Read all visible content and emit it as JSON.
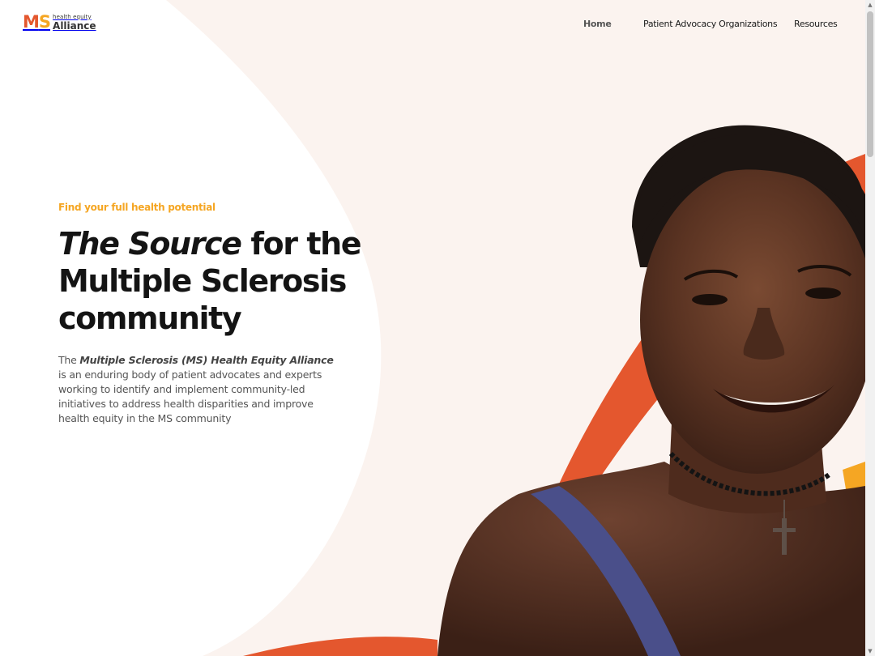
{
  "header": {
    "logo": {
      "ms_m": "M",
      "ms_s": "S",
      "small_text": "health equity",
      "big_text": "Alliance"
    },
    "nav": {
      "home": "Home",
      "patient_advocacy": "Patient Advocacy Organizations",
      "resources": "Resources"
    }
  },
  "hero": {
    "eyebrow": "Find your full health potential",
    "headline_emphasis": "The Source",
    "headline_rest_line1": " for the",
    "headline_line2": "Multiple Sclerosis",
    "headline_line3": "community",
    "body_prefix": "The ",
    "body_emphasis": "Multiple Sclerosis (MS) Health Equity Alliance",
    "body_rest": " is an enduring body of patient advocates and experts working to identify and implement community-led initiatives to address health disparities and improve health equity in the MS community"
  },
  "colors": {
    "brand_orange": "#e4572e",
    "brand_yellow": "#f5a623",
    "cream_bg": "#fbf3ef",
    "text_dark": "#141414"
  },
  "icons": {
    "scroll_up": "scroll-up-arrow-icon",
    "scroll_down": "scroll-down-arrow-icon"
  }
}
